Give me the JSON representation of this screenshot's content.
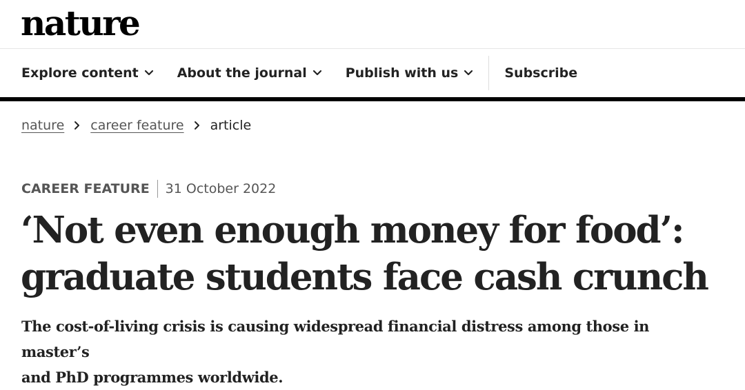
{
  "header": {
    "logo_text": "nature"
  },
  "nav": {
    "items": [
      {
        "label": "Explore content",
        "has_dropdown": true
      },
      {
        "label": "About the journal",
        "has_dropdown": true
      },
      {
        "label": "Publish with us",
        "has_dropdown": true
      }
    ],
    "subscribe_label": "Subscribe"
  },
  "breadcrumb": {
    "items": [
      "nature",
      "career feature"
    ],
    "current": "article"
  },
  "article": {
    "type": "CAREER FEATURE",
    "date": "31 October 2022",
    "title_line1": "‘Not even enough money for food’:",
    "title_line2": "graduate students face cash crunch",
    "standfirst_line1": "The cost-of-living crisis is causing widespread financial distress among those in master’s",
    "standfirst_line2": "and PhD programmes worldwide."
  },
  "icons": {
    "dropdown": "chevron-down-icon",
    "breadcrumb_separator": "chevron-right-icon"
  },
  "colors": {
    "text": "#222222",
    "muted": "#555555",
    "rule": "#000000"
  }
}
